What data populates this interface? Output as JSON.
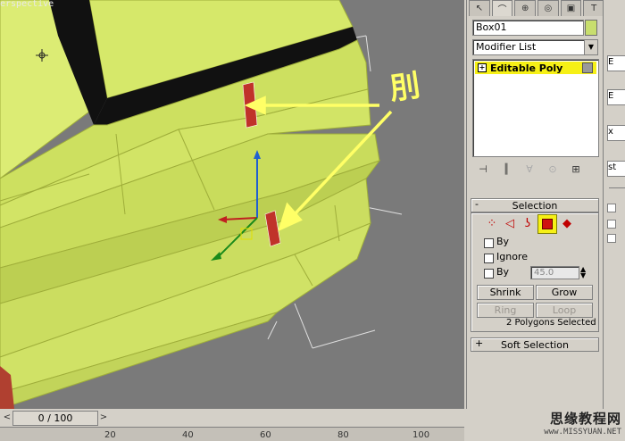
{
  "viewport": {
    "label": "erspective",
    "annotation": "刖"
  },
  "command_panel": {
    "tabs": [
      "create-icon",
      "modify-icon",
      "hierarchy-icon",
      "motion-icon",
      "display-icon",
      "utilities-icon"
    ],
    "object_name": "Box01",
    "object_color": "#c8de6e",
    "modifier_list": "Modifier List",
    "stack_item": "Editable Poly",
    "stack_icons": [
      "pin-icon",
      "show-end-result-icon",
      "make-unique-icon",
      "remove-modifier-icon",
      "configure-icon"
    ]
  },
  "selection": {
    "title": "Selection",
    "sign": "-",
    "subobjects": [
      "vertex-icon",
      "edge-icon",
      "border-icon",
      "polygon-icon",
      "element-icon"
    ],
    "active_subobject": "polygon-icon",
    "by_vertex_label": "By",
    "ignore_backfacing_label": "Ignore",
    "by_angle_label": "By",
    "angle_value": "45.0",
    "shrink_label": "Shrink",
    "grow_label": "Grow",
    "ring_label": "Ring",
    "loop_label": "Loop",
    "status": "2 Polygons Selected"
  },
  "soft_selection": {
    "title": "Soft Selection",
    "sign": "+"
  },
  "right_strip": {
    "items": [
      "E",
      "E",
      "x",
      "st"
    ]
  },
  "timeline": {
    "frame": "0 / 100",
    "ticks": [
      "20",
      "40",
      "60",
      "80",
      "100"
    ]
  },
  "watermark": {
    "line1": "思缘教程网",
    "line2": "www.MISSYUAN.NET"
  },
  "colors": {
    "mesh": "#d6e86a",
    "selected_face": "#c0322a",
    "annotation_arrow": "#ffff66",
    "highlight": "#f6f016"
  }
}
